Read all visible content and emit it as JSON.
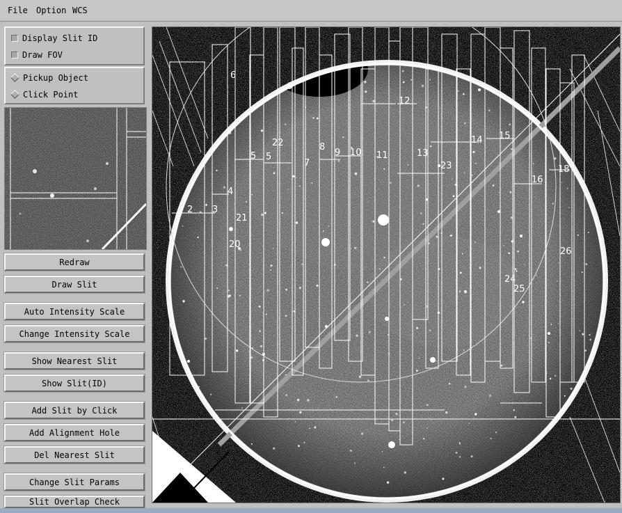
{
  "menu": {
    "file": "File",
    "option": "Option",
    "wcs": "WCS"
  },
  "display_options": {
    "display_slit_id": "Display Slit ID",
    "draw_fov": "Draw FOV"
  },
  "mode_options": {
    "pickup_object": "Pickup Object",
    "click_point": "Click Point"
  },
  "buttons": {
    "redraw": "Redraw",
    "draw_slit": "Draw Slit",
    "auto_intensity_scale": "Auto Intensity Scale",
    "change_intensity_scale": "Change Intensity Scale",
    "show_nearest_slit": "Show Nearest Slit",
    "show_slit_id": "Show Slit(ID)",
    "add_slit_by_click": "Add Slit by Click",
    "add_alignment_hole": "Add Alignment Hole",
    "del_nearest_slit": "Del Nearest Slit",
    "change_slit_params": "Change Slit Params",
    "slit_overlap_check": "Slit Overlap Check"
  },
  "slit_labels": [
    "2",
    "3",
    "4",
    "5",
    "5",
    "6",
    "6",
    "7",
    "8",
    "9",
    "10",
    "11",
    "12",
    "13",
    "14",
    "15",
    "16",
    "18",
    "20",
    "21",
    "22",
    "23",
    "24",
    "25",
    "26"
  ],
  "colors": {
    "panel_bg": "#c0c0c0",
    "image_bg": "#000000",
    "overlay": "#ffffff"
  }
}
